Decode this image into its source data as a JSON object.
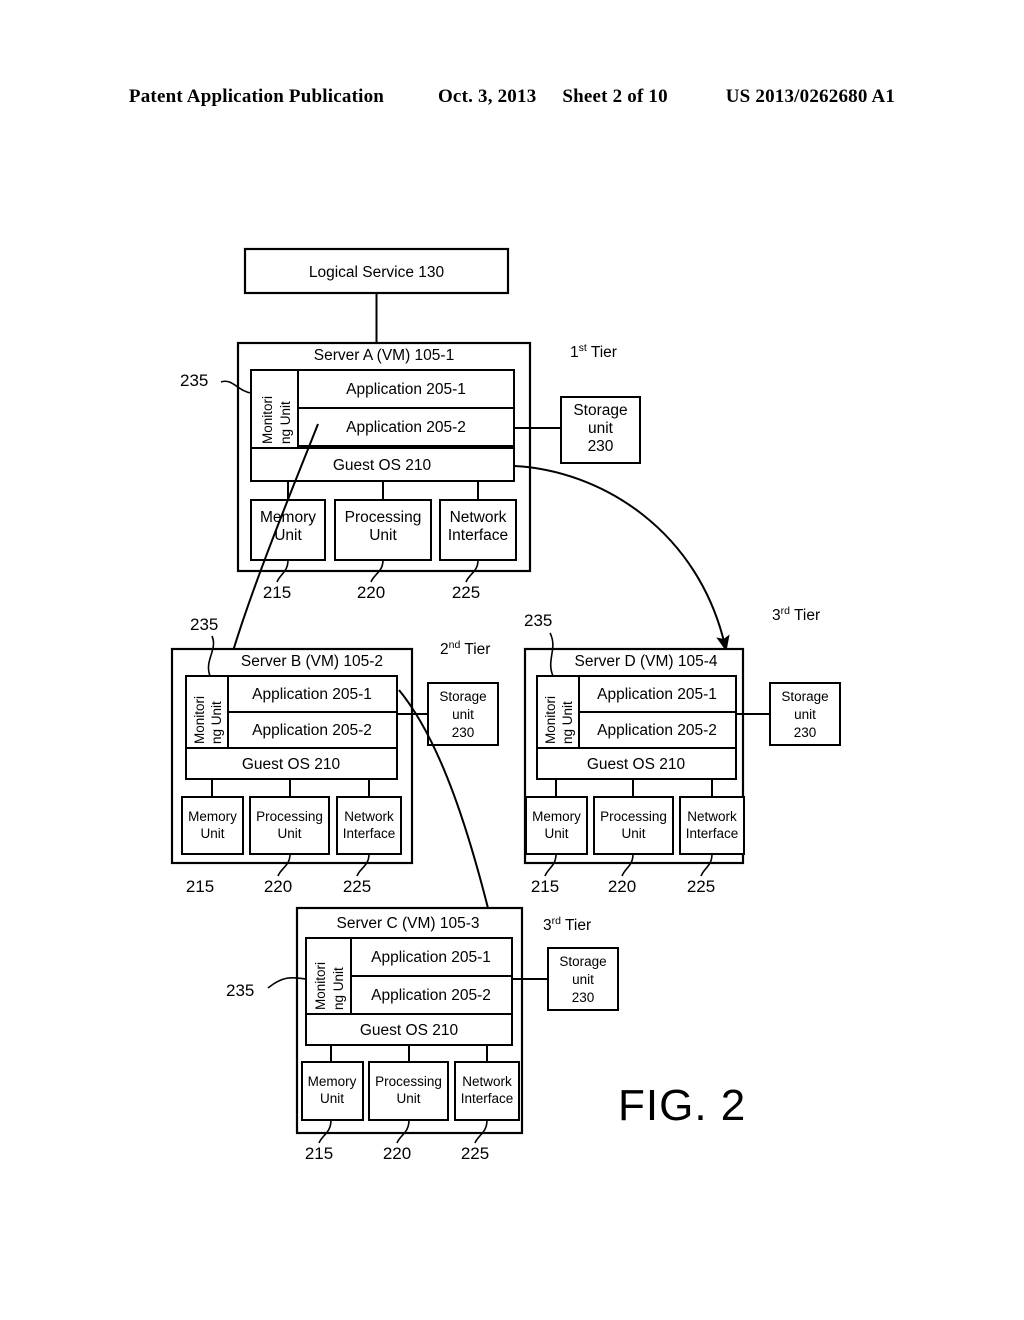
{
  "header": {
    "publication": "Patent Application Publication",
    "date": "Oct. 3, 2013",
    "sheet": "Sheet 2 of 10",
    "pub_number": "US 2013/0262680 A1"
  },
  "figure": {
    "label": "FIG. 2",
    "logical_service": "Logical Service 130",
    "monitoring_unit_line1": "Monitori",
    "monitoring_unit_line2": "ng Unit",
    "app1": "Application 205-1",
    "app2": "Application 205-2",
    "guest_os": "Guest OS 210",
    "memory_unit_l1": "Memory",
    "memory_unit_l2": "Unit",
    "processing_unit_l1": "Processing",
    "processing_unit_l2": "Unit",
    "network_interface_l1": "Network",
    "network_interface_l2": "Interface",
    "storage_l1": "Storage",
    "storage_l2": "unit",
    "storage_l3": "230",
    "ref_215": "215",
    "ref_220": "220",
    "ref_225": "225",
    "ref_235": "235"
  },
  "servers": [
    {
      "id": "server-a",
      "title": "Server A (VM) 105-1",
      "tier_num": "1",
      "tier_sup": "st",
      "tier_word": "Tier"
    },
    {
      "id": "server-b",
      "title": "Server B (VM) 105-2",
      "tier_num": "2",
      "tier_sup": "nd",
      "tier_word": "Tier"
    },
    {
      "id": "server-d",
      "title": "Server D (VM) 105-4",
      "tier_num": "3",
      "tier_sup": "rd",
      "tier_word": "Tier"
    },
    {
      "id": "server-c",
      "title": "Server C (VM) 105-3",
      "tier_num": "3",
      "tier_sup": "rd",
      "tier_word": "Tier"
    }
  ]
}
